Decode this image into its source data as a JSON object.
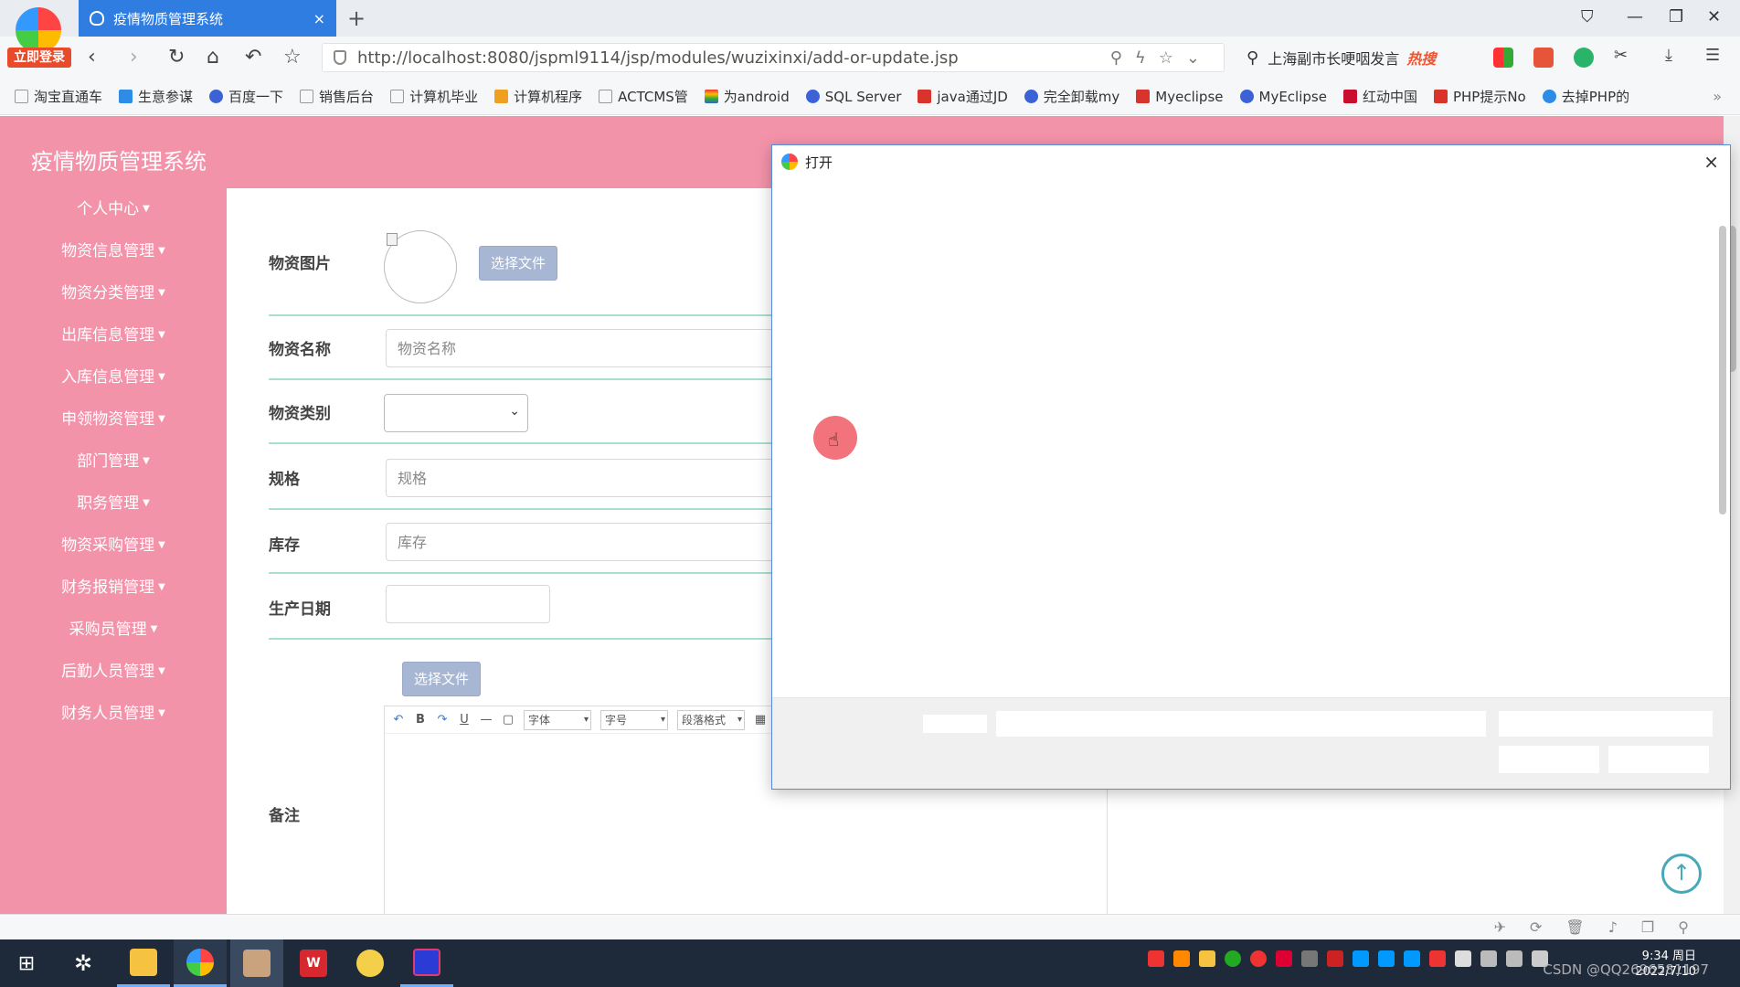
{
  "browser": {
    "login_badge": "立即登录",
    "tab_title": "疫情物质管理系统",
    "tab_close": "×",
    "new_tab": "+",
    "url": "http://localhost:8080/jspml9114/jsp/modules/wuzixinxi/add-or-update.jsp",
    "search_text": "上海副市长哽咽发言",
    "search_hot": "热搜",
    "bookmarks": [
      "淘宝直通车",
      "生意参谋",
      "百度一下",
      "销售后台",
      "计算机毕业",
      "计算机程序",
      "ACTCMS管",
      "为android",
      "SQL Server",
      "java通过JD",
      "完全卸载my",
      "Myeclipse",
      "MyEclipse",
      "红动中国",
      "PHP提示No",
      "去掉PHP的"
    ],
    "bookmark_more": "»"
  },
  "app": {
    "title": "疫情物质管理系统",
    "menu": [
      "个人中心",
      "物资信息管理",
      "物资分类管理",
      "出库信息管理",
      "入库信息管理",
      "申领物资管理",
      "部门管理",
      "职务管理",
      "物资采购管理",
      "财务报销管理",
      "采购员管理",
      "后勤人员管理",
      "财务人员管理"
    ]
  },
  "form": {
    "image_label": "物资图片",
    "choose_file": "选择文件",
    "name_label": "物资名称",
    "name_placeholder": "物资名称",
    "category_label": "物资类别",
    "spec_label": "规格",
    "spec_placeholder": "规格",
    "stock_label": "库存",
    "stock_placeholder": "库存",
    "date_label": "生产日期",
    "choose_file_2": "选择文件",
    "remark_label": "备注",
    "editor_font": "字体",
    "editor_size": "字号",
    "editor_format": "段落格式"
  },
  "dialog": {
    "title": "打开",
    "close": "×"
  },
  "taskbar": {
    "time": "9:34 周日",
    "date": "2022/7/10",
    "watermark": "CSDN @QQ2696581197"
  },
  "colors": {
    "app_pink": "#f393aa",
    "tab_blue": "#2f7de1",
    "row_divider": "#a8dfd1",
    "file_button": "#a7b6d3"
  }
}
